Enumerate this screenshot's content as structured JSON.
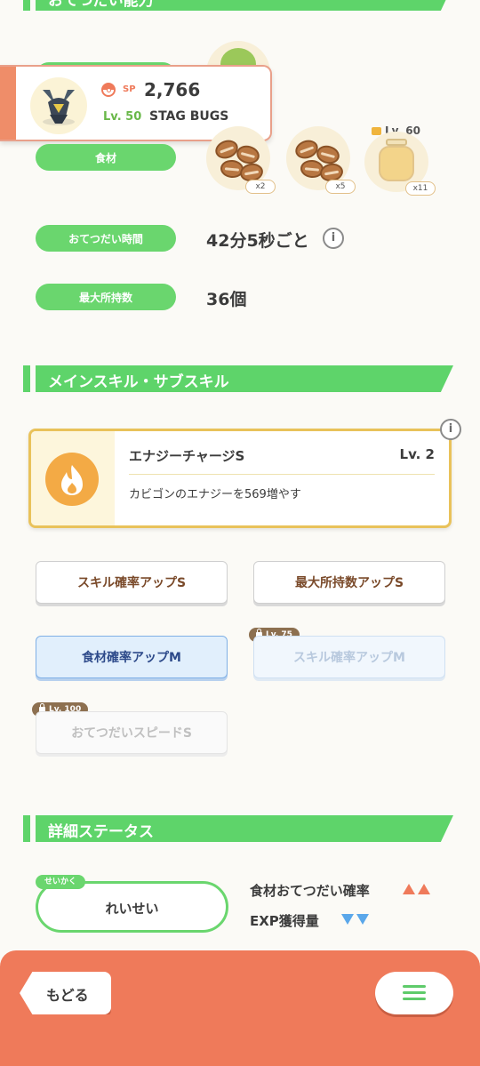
{
  "top_section": {
    "title": "おてつだい能力"
  },
  "pokemon": {
    "sp_label": "SP",
    "sp_value": "2,766",
    "level": "Lv. 50",
    "name": "STAG BUGS"
  },
  "ingredients": {
    "label": "食材",
    "items": [
      {
        "name": "coffee-beans",
        "qty": "x2"
      },
      {
        "name": "coffee-beans",
        "qty": "x5"
      },
      {
        "name": "honey-jar",
        "qty": "x11",
        "lock_level": "Lv. 60"
      }
    ]
  },
  "help_time": {
    "label": "おてつだい時間",
    "value": "42分5秒ごと"
  },
  "max_carry": {
    "label": "最大所持数",
    "value": "36個"
  },
  "skills_section": {
    "title": "メインスキル・サブスキル"
  },
  "main_skill": {
    "name": "エナジーチャージS",
    "level": "Lv. 2",
    "description": "カビゴンのエナジーを569増やす"
  },
  "sub_skills": [
    {
      "label": "スキル確率アップS"
    },
    {
      "label": "最大所持数アップS"
    },
    {
      "label": "食材確率アップM"
    },
    {
      "label": "スキル確率アップM",
      "lock_level": "Lv. 75"
    },
    {
      "label": "おてつだいスピードS",
      "lock_level": "Lv. 100"
    }
  ],
  "detail_section": {
    "title": "詳細ステータス"
  },
  "nature": {
    "tag": "せいかく",
    "value": "れいせい",
    "up_stat": "食材おてつだい確率",
    "down_stat": "EXP獲得量",
    "up_color": "#ef7a5a",
    "down_color": "#5aa7ea"
  },
  "footer": {
    "back_label": "もどる"
  }
}
